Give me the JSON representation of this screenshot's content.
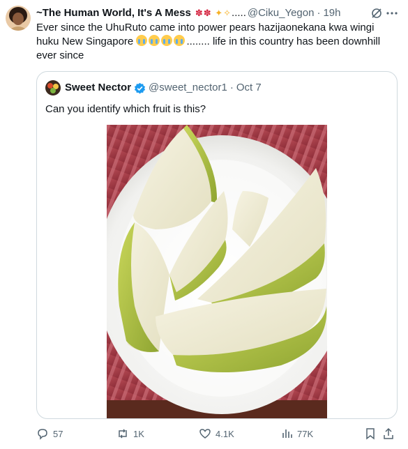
{
  "tweet": {
    "author_name": "~The Human World, It's A Mess",
    "handle": "@Ciku_Yegon",
    "separator": "·",
    "time": "19h",
    "trailing_dots": ".....",
    "text_part1": "Ever since the UhuRuto came into power pears hazijaonekana kwa wingi huku New Singapore",
    "text_part2": "........ life in this country has been downhill ever since"
  },
  "quoted": {
    "author_name": "Sweet Nector",
    "handle": "@sweet_nector1",
    "separator": "·",
    "date": "Oct 7",
    "text": "Can you identify which fruit is this?"
  },
  "actions": {
    "replies": "57",
    "reposts": "1K",
    "likes": "4.1K",
    "views": "77K"
  },
  "colors": {
    "text": "#0f1419",
    "secondary": "#536471",
    "border": "#cfd9de",
    "verified": "#1d9bf0"
  }
}
